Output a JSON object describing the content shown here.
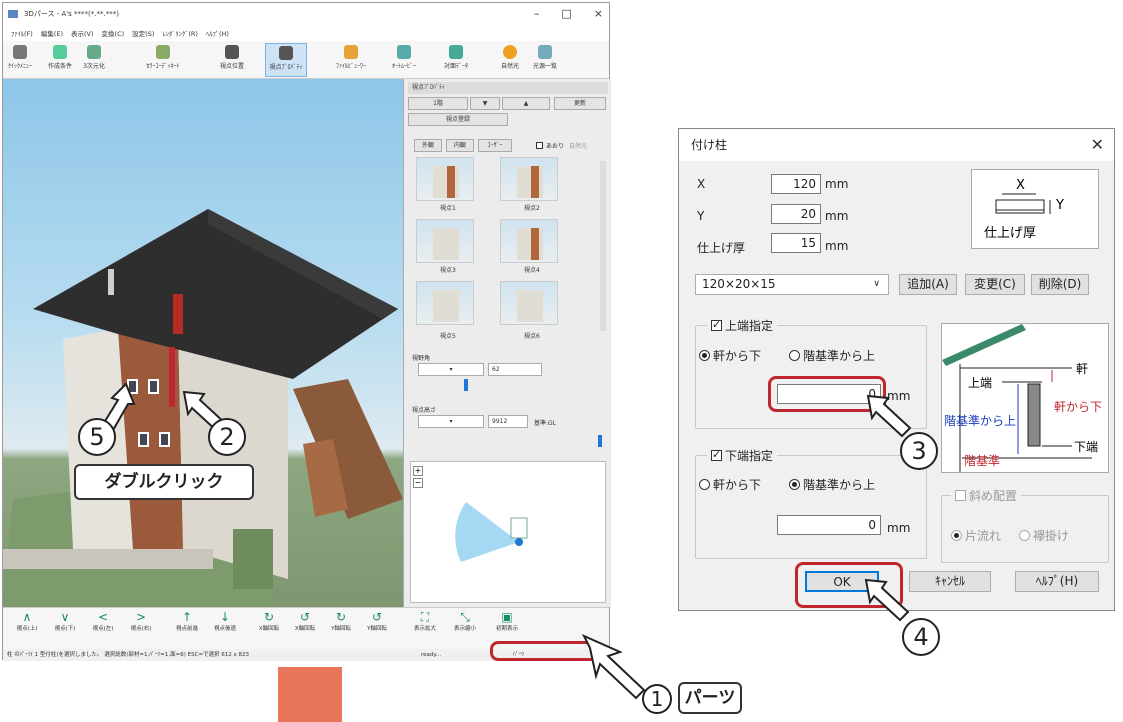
{
  "app": {
    "title": "3Dパース - A's ****(*.**.***)",
    "window_controls": [
      "–",
      "□",
      "×"
    ],
    "menu": [
      "ﾌｧｲﾙ(F)",
      "編集(E)",
      "表示(V)",
      "変換(C)",
      "設定(S)",
      "ﾚﾝﾀﾞﾘﾝｸﾞ(R)",
      "ﾍﾙﾌﾟ(H)"
    ],
    "toolbar": [
      "ｸｲｯｸﾒﾆｭｰ",
      "作成条件",
      "3次元化",
      "ｶﾗｰｺｰﾃﾞｨﾈｰﾄ",
      "視点位置",
      "視点ﾌﾟﾛﾊﾟﾃｨ",
      "ﾌｧｲﾙﾋﾞｭｰﾜｰ",
      "ｵｰﾄﾑｰﾋﾞｰ",
      "対面ﾃﾞｰﾀ",
      "自然光",
      "光源一覧"
    ],
    "bottom_nav": [
      "視点(上)",
      "視点(下)",
      "視点(左)",
      "視点(右)",
      "視点前進",
      "視点後退",
      "X軸回転",
      "X軸回転",
      "Y軸回転",
      "Y軸回転",
      "表示拡大",
      "表示縮小",
      "初期表示"
    ],
    "statusbar": "柱 のﾊﾟｰﾂ( 1 型付柱)を選択しました。 選択総数(部材=1,ﾊﾟｰﾂ=1,面=6)  ESC=で選択 612 x 823",
    "status_ready": "ready...",
    "status_mode": "ﾊﾟｰﾂ"
  },
  "viewprop": {
    "header": "視点ﾌﾟﾛﾊﾟﾃｨ",
    "floor": "1階",
    "update_btn": "更新",
    "register_btn": "視点登録",
    "tabs": [
      "外観",
      "内観",
      "ﾕｰｻﾞｰ"
    ],
    "check_ari": "あおり",
    "check_natural": "自然光",
    "thumbs": [
      "視点1",
      "視点2",
      "視点3",
      "視点4",
      "視点5",
      "視点6"
    ],
    "fov_label": "視野角",
    "fov_value": "62",
    "height_label": "視点高さ",
    "height_value": "9912",
    "height_base": "基準:GL"
  },
  "dialog": {
    "title": "付け柱",
    "x_label": "X",
    "x_value": "120",
    "y_label": "Y",
    "y_value": "20",
    "finish_label": "仕上げ厚",
    "finish_value": "15",
    "unit": "mm",
    "preset": "120×20×15",
    "add_btn": "追加(A)",
    "change_btn": "変更(C)",
    "delete_btn": "削除(D)",
    "top_group": "上端指定",
    "opt_from_eave": "軒から下",
    "opt_from_floor": "階基準から上",
    "top_value": "0",
    "bottom_group": "下端指定",
    "bottom_value": "0",
    "diag_group": "斜め配置",
    "diag_opt1": "片流れ",
    "diag_opt2": "襷掛け",
    "ok_btn": "OK",
    "cancel_btn": "ｷｬﾝｾﾙ",
    "help_btn": "ﾍﾙﾌﾟ(H)",
    "fig_x": "X",
    "fig_y": "Y",
    "fig_finish": "仕上げ厚",
    "fig_eave": "軒",
    "fig_top": "上端",
    "fig_from_eave": "軒から下",
    "fig_from_floor": "階基準から上",
    "fig_bottom": "下端",
    "fig_floor": "階基準"
  },
  "annotations": {
    "n1": "1",
    "n2": "2",
    "n3": "3",
    "n4": "4",
    "n5": "5",
    "parts": "パーツ",
    "double_click": "ダブルクリック"
  },
  "colors": {
    "highlight": "#c0262d",
    "accent_orange": "#e8765b"
  }
}
